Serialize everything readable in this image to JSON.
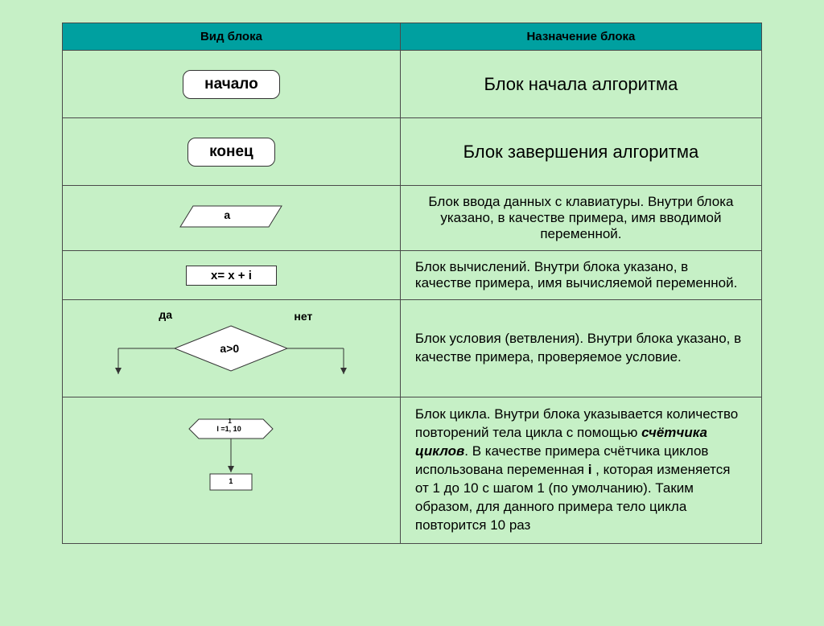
{
  "header": {
    "left": "Вид блока",
    "right": "Назначение блока"
  },
  "rows": [
    {
      "shape_label": "начало",
      "desc": "Блок начала алгоритма"
    },
    {
      "shape_label": "конец",
      "desc": "Блок завершения алгоритма"
    },
    {
      "shape_label": "a",
      "desc": "Блок ввода данных с клавиатуры. Внутри блока указано, в качестве примера, имя вводимой переменной."
    },
    {
      "shape_label": "x= x + i",
      "desc": "Блок вычислений. Внутри блока указано, в качестве примера, имя вычисляемой переменной."
    },
    {
      "shape_label": "a>0",
      "yes": "да",
      "no": "нет",
      "desc": "Блок условия (ветвления). Внутри блока указано, в качестве примера, проверяемое условие."
    },
    {
      "shape_label_top": "1",
      "shape_label_line2": "I =1, 10",
      "shape_label_bottom": "1",
      "desc_prefix": "Блок цикла. Внутри блока указывается количество повторений тела цикла с помощью ",
      "desc_bold": "счётчика циклов",
      "desc_mid": ". В качестве примера счётчика циклов использована переменная ",
      "desc_var": "i",
      "desc_suffix": " , которая изменяется от 1 до 10 с шагом 1 (по умолчанию). Таким образом, для данного примера тело цикла повторится 10 раз"
    }
  ]
}
